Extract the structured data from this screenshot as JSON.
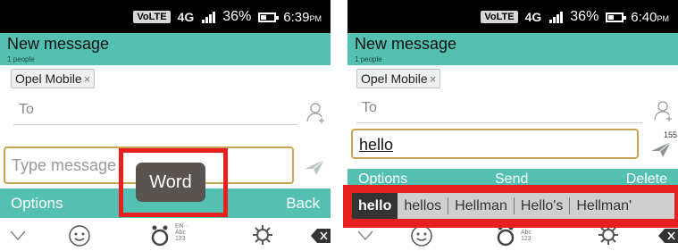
{
  "left": {
    "status": {
      "volte": "VoLTE",
      "network": "4G",
      "battery_pct": "36%",
      "time": "6:39",
      "ampm": "PM"
    },
    "header": {
      "title": "New message",
      "subtitle": "1 people"
    },
    "recipient_chip": {
      "label": "Opel Mobile",
      "remove": "×"
    },
    "to_label": "To",
    "compose": {
      "placeholder": "Type message"
    },
    "toolbar": {
      "left": "Options",
      "right": "Back"
    },
    "popup": {
      "label": "Word"
    },
    "ime": {
      "line1": "EN··",
      "line2": "Abc",
      "line3": "123"
    }
  },
  "right": {
    "status": {
      "volte": "VoLTE",
      "network": "4G",
      "battery_pct": "36%",
      "time": "6:40",
      "ampm": "PM"
    },
    "header": {
      "title": "New message",
      "subtitle": "1 people"
    },
    "recipient_chip": {
      "label": "Opel Mobile",
      "remove": "×"
    },
    "to_label": "To",
    "compose": {
      "value": "hello",
      "counter": "155"
    },
    "toolbar": {
      "left": "Options",
      "mid": "Send",
      "right": "Delete"
    },
    "suggestions": [
      "hello",
      "hellos",
      "Hellman",
      "Hello's",
      "Hellman'"
    ],
    "ime": {
      "line1": "EN··",
      "line2": "Abc",
      "line3": "123"
    }
  },
  "colors": {
    "header": "#53c0b1",
    "compose_border": "#c9a552",
    "highlight": "#e81f1f",
    "popup": "#5a5450",
    "suggestion_bar": "#cfcfcf"
  },
  "icons": [
    "chevron-down-icon",
    "smiley-icon",
    "ime-switch-icon",
    "gear-icon",
    "backspace-icon",
    "add-contact-icon",
    "send-icon"
  ]
}
